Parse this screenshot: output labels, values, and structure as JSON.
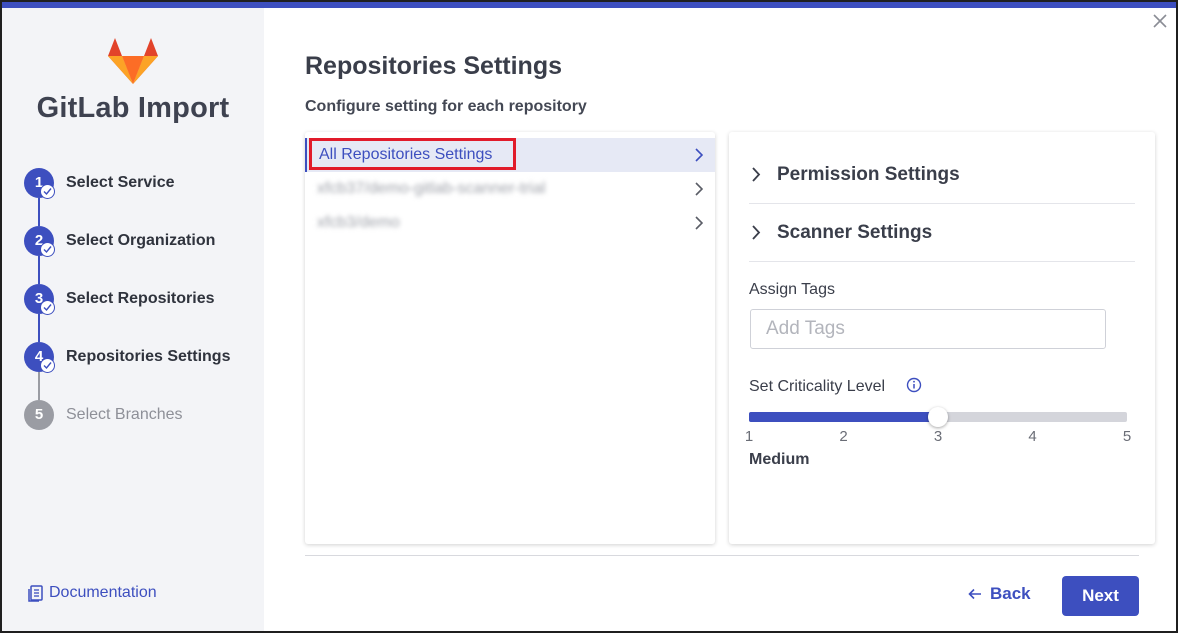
{
  "app": {
    "title": "GitLab Import"
  },
  "steps": [
    {
      "number": "1",
      "label": "Select Service",
      "state": "done"
    },
    {
      "number": "2",
      "label": "Select Organization",
      "state": "done"
    },
    {
      "number": "3",
      "label": "Select Repositories",
      "state": "done"
    },
    {
      "number": "4",
      "label": "Repositories Settings",
      "state": "current"
    },
    {
      "number": "5",
      "label": "Select Branches",
      "state": "pending"
    }
  ],
  "sidebar": {
    "documentation_label": "Documentation"
  },
  "main": {
    "title": "Repositories Settings",
    "subtitle": "Configure setting for each repository"
  },
  "repo_list": {
    "items": [
      {
        "label": "All Repositories Settings",
        "active": true,
        "blurred": false
      },
      {
        "label": "xfcb37/demo-gitlab-scanner-trial",
        "active": false,
        "blurred": true
      },
      {
        "label": "xfcb3/demo",
        "active": false,
        "blurred": true
      }
    ]
  },
  "settings": {
    "permission_title": "Permission Settings",
    "scanner_title": "Scanner Settings",
    "assign_tags_label": "Assign Tags",
    "tags_placeholder": "Add Tags",
    "criticality_label": "Set Criticality Level",
    "criticality_ticks": [
      "1",
      "2",
      "3",
      "4",
      "5"
    ],
    "criticality_value": 3,
    "criticality_text": "Medium"
  },
  "footer": {
    "back_label": "Back",
    "next_label": "Next"
  },
  "colors": {
    "accent": "#3d4fbf",
    "highlight": "#e11b2a",
    "sidebar_bg": "#f3f4f7"
  },
  "icons": [
    "gitlab-logo",
    "check-icon",
    "document-icon",
    "close-icon",
    "chevron-right-icon",
    "info-icon",
    "arrow-left-icon"
  ]
}
